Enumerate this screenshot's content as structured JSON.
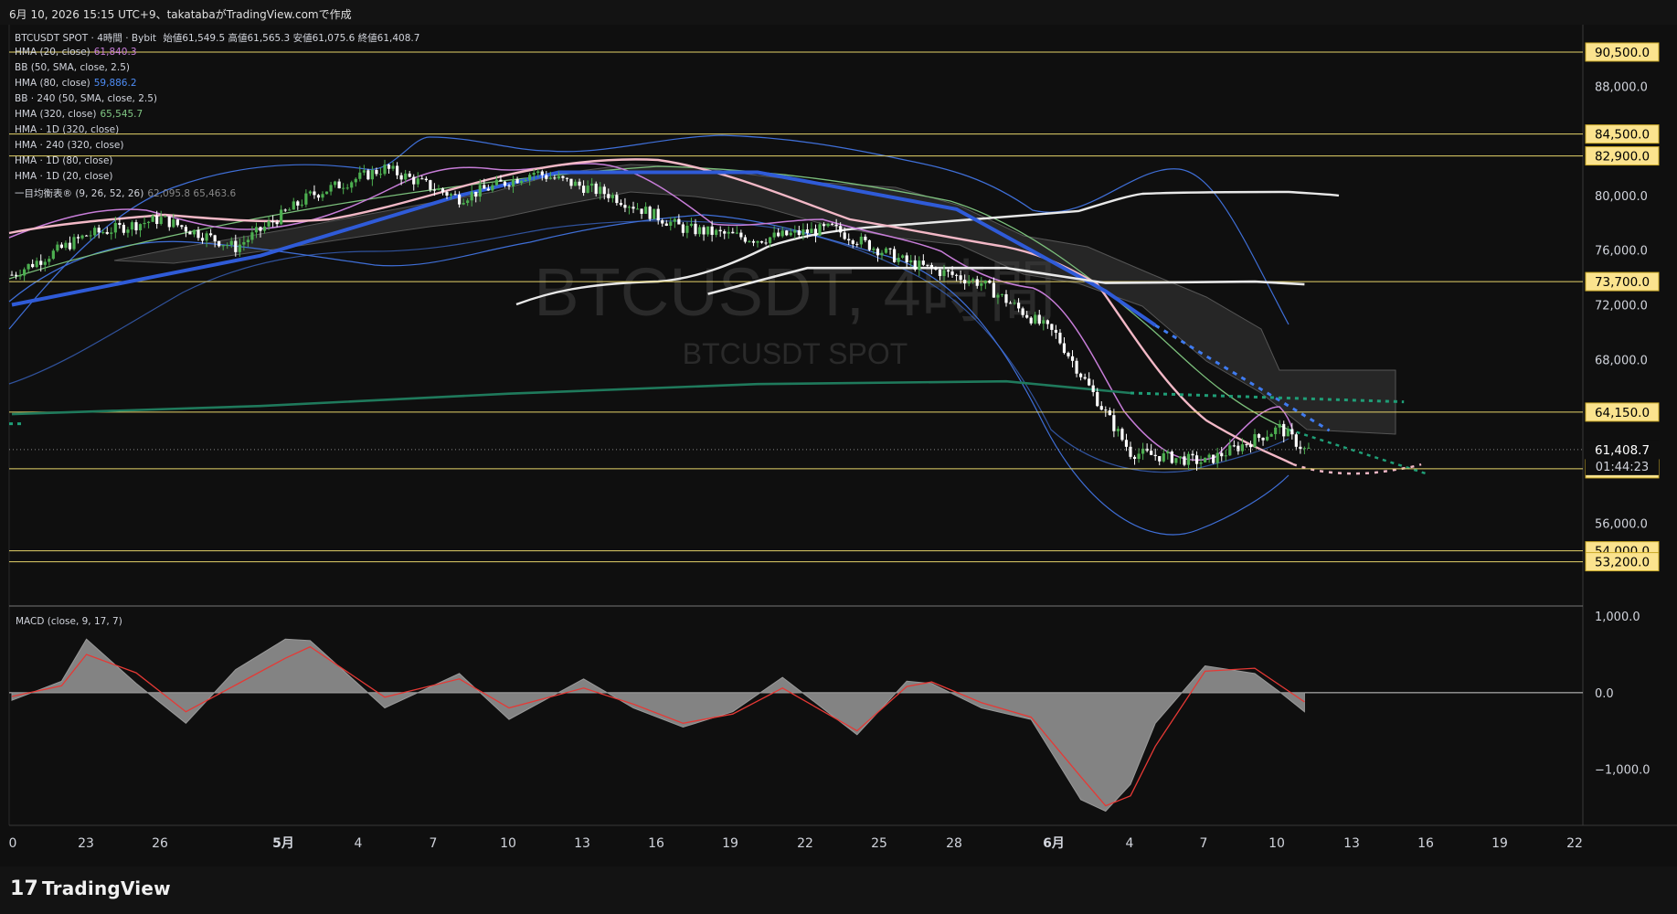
{
  "header": {
    "caption": "6月 10, 2026 15:15 UTC+9、takatabaがTradingView.comで作成"
  },
  "watermark": {
    "main": "BTCUSDT, 4時間",
    "sub": "BTCUSDT SPOT"
  },
  "legend": {
    "title": "BTCUSDT SPOT · 4時間 · Bybit",
    "ohlc": "始値61,549.5  高値61,565.3  安値61,075.6  終値61,408.7",
    "items": [
      {
        "label": "HMA (20, close)",
        "value": "61,840.3",
        "color": "#c77dd8"
      },
      {
        "label": "BB (50, SMA, close, 2.5)",
        "value": "",
        "color": "#2962ff"
      },
      {
        "label": "HMA (80, close)",
        "value": "59,886.2",
        "color": "#4d8cf5"
      },
      {
        "label": "BB · 240 (50, SMA, close, 2.5)",
        "value": "",
        "color": "#888888"
      },
      {
        "label": "HMA (320, close)",
        "value": "65,545.7",
        "color": "#81c784"
      },
      {
        "label": "HMA · 1D (320, close)",
        "value": "",
        "color": "#888888"
      },
      {
        "label": "HMA · 240 (320, close)",
        "value": "",
        "color": "#888888"
      },
      {
        "label": "HMA · 1D (80, close)",
        "value": "",
        "color": "#888888"
      },
      {
        "label": "HMA · 1D (20, close)",
        "value": "",
        "color": "#888888"
      },
      {
        "label": "一目均衡表® (9, 26, 52, 26)",
        "value": "62,095.8  65,463.6",
        "color": "#888888"
      }
    ]
  },
  "price_axis": {
    "ticks": [
      "88,000.0",
      "80,000.0",
      "76,000.0",
      "72,000.0",
      "68,000.0",
      "56,000.0"
    ],
    "levels": [
      "90,500.0",
      "84,500.0",
      "82,900.0",
      "73,700.0",
      "64,150.0",
      "60,000.0",
      "54,000.0",
      "53,200.0"
    ],
    "last_price": "61,408.7",
    "countdown": "01:44:23"
  },
  "macd": {
    "label": "MACD (close, 9, 17, 7)",
    "ticks": [
      "1,000.0",
      "0.0",
      "−1,000.0"
    ]
  },
  "time_axis": [
    "0",
    "23",
    "26",
    "5月",
    "4",
    "7",
    "10",
    "13",
    "16",
    "19",
    "22",
    "25",
    "28",
    "6月",
    "4",
    "7",
    "10",
    "13",
    "16",
    "19",
    "22"
  ],
  "chart_data": {
    "type": "line",
    "title": "BTCUSDT, 4時間",
    "ylim": [
      51500,
      91500
    ],
    "h_levels": [
      90500,
      84500,
      82900,
      73700,
      64150,
      60000,
      54000,
      53200
    ],
    "price_ticks": [
      88000,
      80000,
      76000,
      72000,
      68000,
      56000
    ],
    "last_price": 61408.7,
    "x_days": [
      20,
      23,
      26,
      29,
      32,
      35,
      38,
      41,
      44,
      47,
      50,
      53,
      56,
      59,
      62,
      65,
      68,
      71,
      72
    ],
    "price_series": [
      74200,
      77100,
      78300,
      76200,
      80000,
      82000,
      79800,
      81700,
      80100,
      77600,
      76800,
      77600,
      75100,
      73600,
      69800,
      61200,
      60500,
      63000,
      61400
    ],
    "series": [
      {
        "name": "HMA (320, close)",
        "x": [
          20,
          30,
          40,
          50,
          60,
          65
        ],
        "values": [
          64000,
          64600,
          65500,
          66200,
          66400,
          65550
        ],
        "color": "#1f7a5c"
      },
      {
        "name": "HMA · 1D (80, close)",
        "x": [
          20,
          30,
          38,
          42,
          50,
          58,
          64,
          66
        ],
        "values": [
          72000,
          75600,
          80000,
          81700,
          81700,
          79000,
          73000,
          70500
        ],
        "color": "#2f5bd8"
      },
      {
        "name": "HMA · 1D (20, close)",
        "x": [
          48,
          52,
          60,
          64,
          70,
          72
        ],
        "values": [
          72800,
          74700,
          74700,
          73600,
          73700,
          73500
        ],
        "color": "#e8e8e8"
      }
    ],
    "macd": {
      "ylim": [
        -1700,
        1050
      ],
      "x_days": [
        20,
        22,
        23,
        25,
        27,
        29,
        31,
        32,
        35,
        38,
        40,
        43,
        45,
        47,
        49,
        51,
        54,
        56,
        57,
        59,
        61,
        63,
        64,
        65,
        66,
        68,
        70,
        71,
        72
      ],
      "histogram": [
        -100,
        150,
        700,
        120,
        -400,
        300,
        700,
        680,
        -200,
        250,
        -350,
        180,
        -200,
        -450,
        -250,
        200,
        -550,
        150,
        120,
        -200,
        -350,
        -1400,
        -1550,
        -1200,
        -400,
        350,
        250,
        10,
        -250
      ],
      "signal": [
        -50,
        90,
        500,
        260,
        -250,
        100,
        450,
        600,
        -60,
        180,
        -200,
        60,
        -150,
        -400,
        -280,
        60,
        -500,
        80,
        140,
        -130,
        -320,
        -1100,
        -1480,
        -1350,
        -700,
        280,
        320,
        100,
        -120
      ]
    }
  }
}
